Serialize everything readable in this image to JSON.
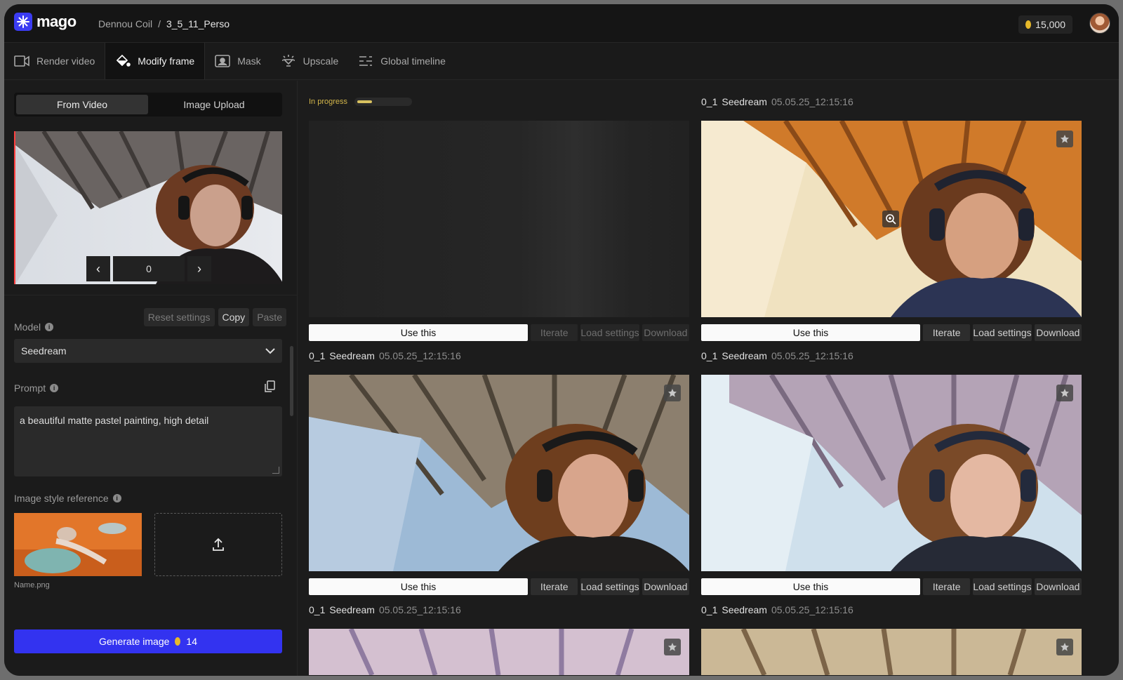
{
  "app": {
    "name": "mago",
    "accent": "#3b3cf2"
  },
  "breadcrumb": {
    "project": "Dennou Coil",
    "separator": "/",
    "current": "3_5_11_Perso"
  },
  "credits": {
    "amount": "15,000",
    "icon": "coin-icon"
  },
  "tabs": [
    {
      "label": "Render video",
      "icon": "video-camera-icon"
    },
    {
      "label": "Modify frame",
      "icon": "paint-bucket-icon",
      "active": true
    },
    {
      "label": "Mask",
      "icon": "mask-icon"
    },
    {
      "label": "Upscale",
      "icon": "upscale-icon"
    },
    {
      "label": "Global timeline",
      "icon": "timeline-icon"
    }
  ],
  "sidebar": {
    "source_toggle": {
      "options": [
        "From Video",
        "Image Upload"
      ],
      "selected": "From Video"
    },
    "frame_number": "0",
    "settings_buttons": {
      "reset": "Reset settings",
      "copy": "Copy",
      "paste": "Paste"
    },
    "model": {
      "label": "Model",
      "value": "Seedream"
    },
    "prompt": {
      "label": "Prompt",
      "value": "a beautiful matte pastel painting, high detail"
    },
    "style_reference": {
      "label": "Image style reference",
      "file_name": "Name.png"
    },
    "generate": {
      "label": "Generate image",
      "cost": "14"
    }
  },
  "results": {
    "in_progress": {
      "label": "In progress",
      "progress": 0.28
    },
    "action_labels": {
      "use": "Use this",
      "iterate": "Iterate",
      "load": "Load settings",
      "download": "Download"
    },
    "cards": [
      {
        "id": "0_1",
        "model": "Seedream",
        "timestamp": "05.05.25_12:15:16"
      },
      {
        "id": "0_1",
        "model": "Seedream",
        "timestamp": "05.05.25_12:15:16"
      },
      {
        "id": "0_1",
        "model": "Seedream",
        "timestamp": "05.05.25_12:15:16"
      },
      {
        "id": "0_1",
        "model": "Seedream",
        "timestamp": "05.05.25_12:15:16"
      },
      {
        "id": "0_1",
        "model": "Seedream",
        "timestamp": "05.05.25_12:15:16"
      }
    ]
  }
}
